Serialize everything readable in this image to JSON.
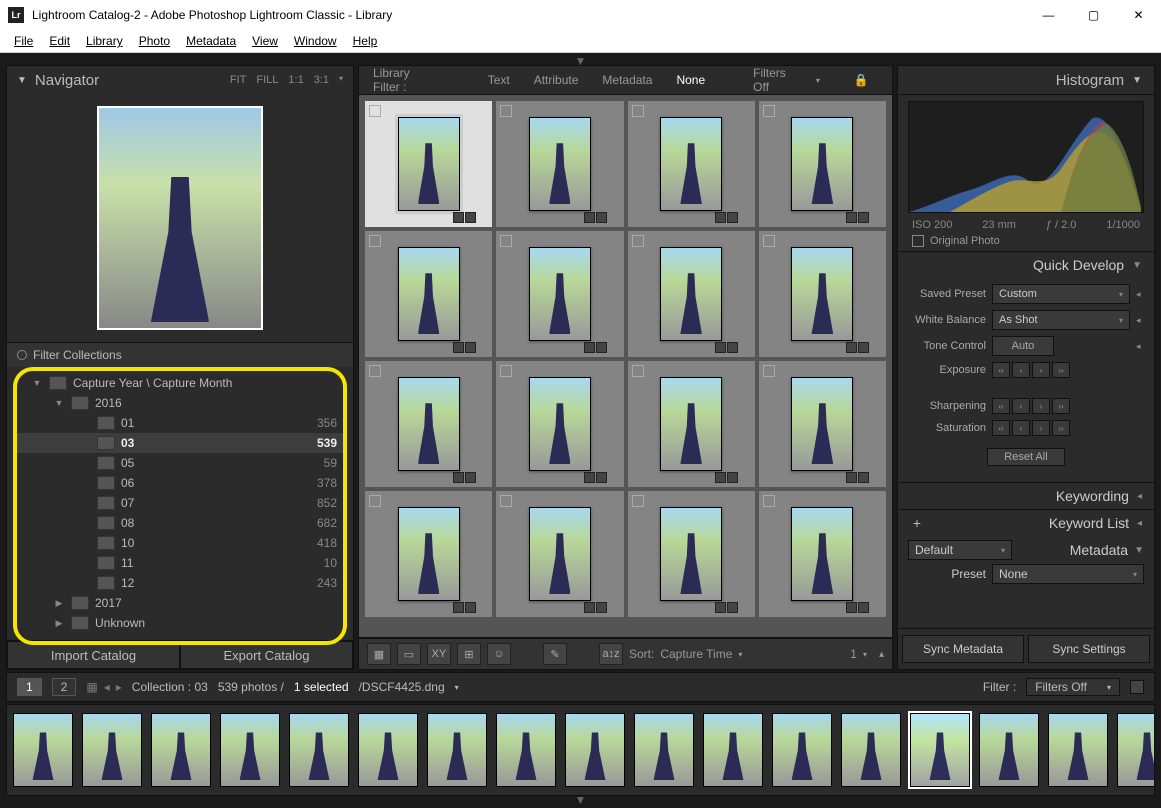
{
  "window": {
    "title": "Lightroom Catalog-2 - Adobe Photoshop Lightroom Classic - Library",
    "icon_text": "Lr"
  },
  "menus": [
    "File",
    "Edit",
    "Library",
    "Photo",
    "Metadata",
    "View",
    "Window",
    "Help"
  ],
  "navigator": {
    "title": "Navigator",
    "opts": [
      "FIT",
      "FILL",
      "1:1",
      "3:1"
    ]
  },
  "filter_collections": {
    "title": "Filter Collections",
    "root": "Capture Year \\ Capture Month",
    "years": [
      {
        "label": "2016",
        "expanded": true,
        "months": [
          {
            "label": "01",
            "count": "356"
          },
          {
            "label": "03",
            "count": "539",
            "selected": true
          },
          {
            "label": "05",
            "count": "59"
          },
          {
            "label": "06",
            "count": "378"
          },
          {
            "label": "07",
            "count": "852"
          },
          {
            "label": "08",
            "count": "682"
          },
          {
            "label": "10",
            "count": "418"
          },
          {
            "label": "11",
            "count": "10"
          },
          {
            "label": "12",
            "count": "243"
          }
        ]
      },
      {
        "label": "2017",
        "expanded": false,
        "months": []
      },
      {
        "label": "Unknown",
        "expanded": false,
        "months": []
      }
    ]
  },
  "catalog_buttons": {
    "import": "Import Catalog",
    "export": "Export Catalog"
  },
  "library_filter": {
    "title": "Library Filter :",
    "tabs": [
      "Text",
      "Attribute",
      "Metadata",
      "None"
    ],
    "active": "None",
    "status": "Filters Off"
  },
  "toolbar": {
    "sort_label": "Sort:",
    "sort_value": "Capture Time",
    "thumb_size": "1"
  },
  "right": {
    "histogram": {
      "title": "Histogram",
      "iso": "ISO 200",
      "focal": "23 mm",
      "aperture": "ƒ / 2.0",
      "shutter": "1/1000",
      "original": "Original Photo"
    },
    "quick_develop": {
      "title": "Quick Develop",
      "saved_preset_lbl": "Saved Preset",
      "saved_preset_val": "Custom",
      "wb_lbl": "White Balance",
      "wb_val": "As Shot",
      "tone_lbl": "Tone Control",
      "auto": "Auto",
      "exposure": "Exposure",
      "sharpening": "Sharpening",
      "saturation": "Saturation",
      "reset": "Reset All"
    },
    "keywording": "Keywording",
    "keyword_list": "Keyword List",
    "kw_default": "Default",
    "metadata": {
      "title": "Metadata",
      "preset_lbl": "Preset",
      "preset_val": "None"
    },
    "sync_meta": "Sync Metadata",
    "sync_settings": "Sync Settings"
  },
  "status": {
    "view1": "1",
    "view2": "2",
    "collection": "Collection : 03",
    "photos": "539 photos /",
    "selected": "1 selected",
    "file": "/DSCF4425.dng",
    "filter_lbl": "Filter :",
    "filter_val": "Filters Off"
  }
}
